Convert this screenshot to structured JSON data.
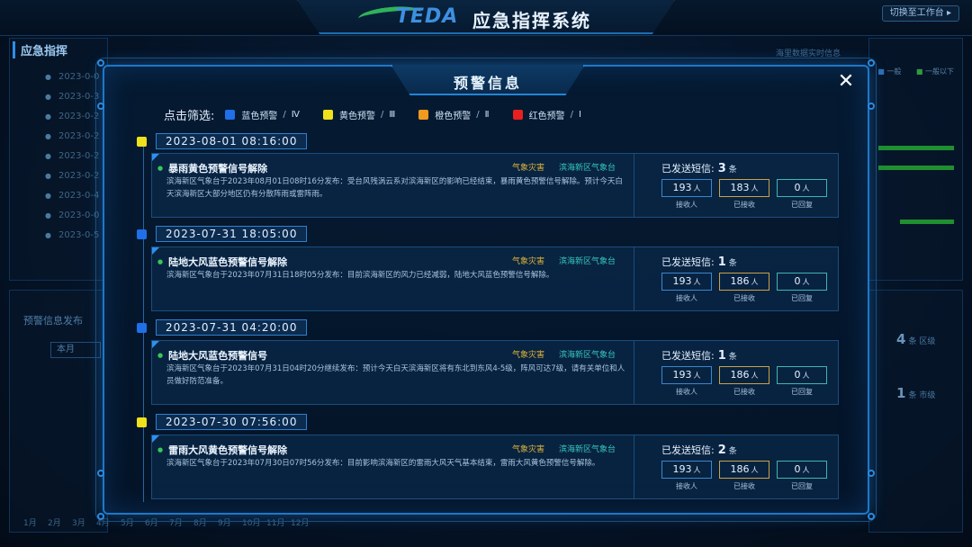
{
  "header": {
    "logo_text": "TEDA",
    "system_title": "应急指挥系统",
    "switch_button": "切换至工作台 ▸"
  },
  "background": {
    "left_title": "应急指挥",
    "left_items": [
      "2023-0-0",
      "2023-0-3",
      "2023-0-2",
      "2023-0-2",
      "2023-0-2",
      "2023-0-2",
      "2023-0-4",
      "2023-0-0",
      "2023-0-5"
    ],
    "left_title2": "预警信息发布",
    "left_select": "本月",
    "months": [
      "1月",
      "2月",
      "3月",
      "4月",
      "5月",
      "6月",
      "7月",
      "8月",
      "9月",
      "10月",
      "11月",
      "12月"
    ],
    "right_legend": [
      "一般",
      "一般以下"
    ],
    "right_stats": [
      {
        "value": "4",
        "unit": "条",
        "label": "区级"
      },
      {
        "value": "1",
        "unit": "条",
        "label": "市级"
      }
    ],
    "top_hint": "海里数据实时信息"
  },
  "modal": {
    "title": "预警信息",
    "close_icon": "close-icon",
    "filter_label": "点击筛选:",
    "filters": [
      {
        "name": "蓝色预警",
        "level": "Ⅳ",
        "color": "#1f6fe8"
      },
      {
        "name": "黄色预警",
        "level": "Ⅲ",
        "color": "#f0e11a"
      },
      {
        "name": "橙色预警",
        "level": "Ⅱ",
        "color": "#f39a1e"
      },
      {
        "name": "红色预警",
        "level": "Ⅰ",
        "color": "#e82020"
      }
    ],
    "separator": "/",
    "sent_label": "已发送短信:",
    "count_unit": "条",
    "person_unit": "人",
    "receivers_label": "接收人",
    "received_label": "已接收",
    "replied_label": "已回复",
    "items": [
      {
        "date": "2023-08-01 08:16:00",
        "color": "#f0e11a",
        "title": "暴雨黄色预警信号解除",
        "tag1": "气象灾害",
        "tag2": "滨海新区气象台",
        "desc": "滨海新区气象台于2023年08月01日08时16分发布：受台风残涡云系对滨海新区的影响已经结束，暴雨黄色预警信号解除。预计今天白天滨海新区大部分地区仍有分散阵雨或雷阵雨。",
        "sent": "3",
        "receivers": "193",
        "received": "183",
        "replied": "0"
      },
      {
        "date": "2023-07-31 18:05:00",
        "color": "#1f6fe8",
        "title": "陆地大风蓝色预警信号解除",
        "tag1": "气象灾害",
        "tag2": "滨海新区气象台",
        "desc": "滨海新区气象台于2023年07月31日18时05分发布：目前滨海新区的风力已经减弱，陆地大风蓝色预警信号解除。",
        "sent": "1",
        "receivers": "193",
        "received": "186",
        "replied": "0"
      },
      {
        "date": "2023-07-31 04:20:00",
        "color": "#1f6fe8",
        "title": "陆地大风蓝色预警信号",
        "tag1": "气象灾害",
        "tag2": "滨海新区气象台",
        "desc": "滨海新区气象台于2023年07月31日04时20分继续发布：预计今天白天滨海新区将有东北到东风4-5级，阵风可达7级，请有关单位和人员做好防范准备。",
        "sent": "1",
        "receivers": "193",
        "received": "186",
        "replied": "0"
      },
      {
        "date": "2023-07-30 07:56:00",
        "color": "#f0e11a",
        "title": "雷雨大风黄色预警信号解除",
        "tag1": "气象灾害",
        "tag2": "滨海新区气象台",
        "desc": "滨海新区气象台于2023年07月30日07时56分发布：目前影响滨海新区的雷雨大风天气基本结束，雷雨大风黄色预警信号解除。",
        "sent": "2",
        "receivers": "193",
        "received": "186",
        "replied": "0"
      }
    ]
  }
}
